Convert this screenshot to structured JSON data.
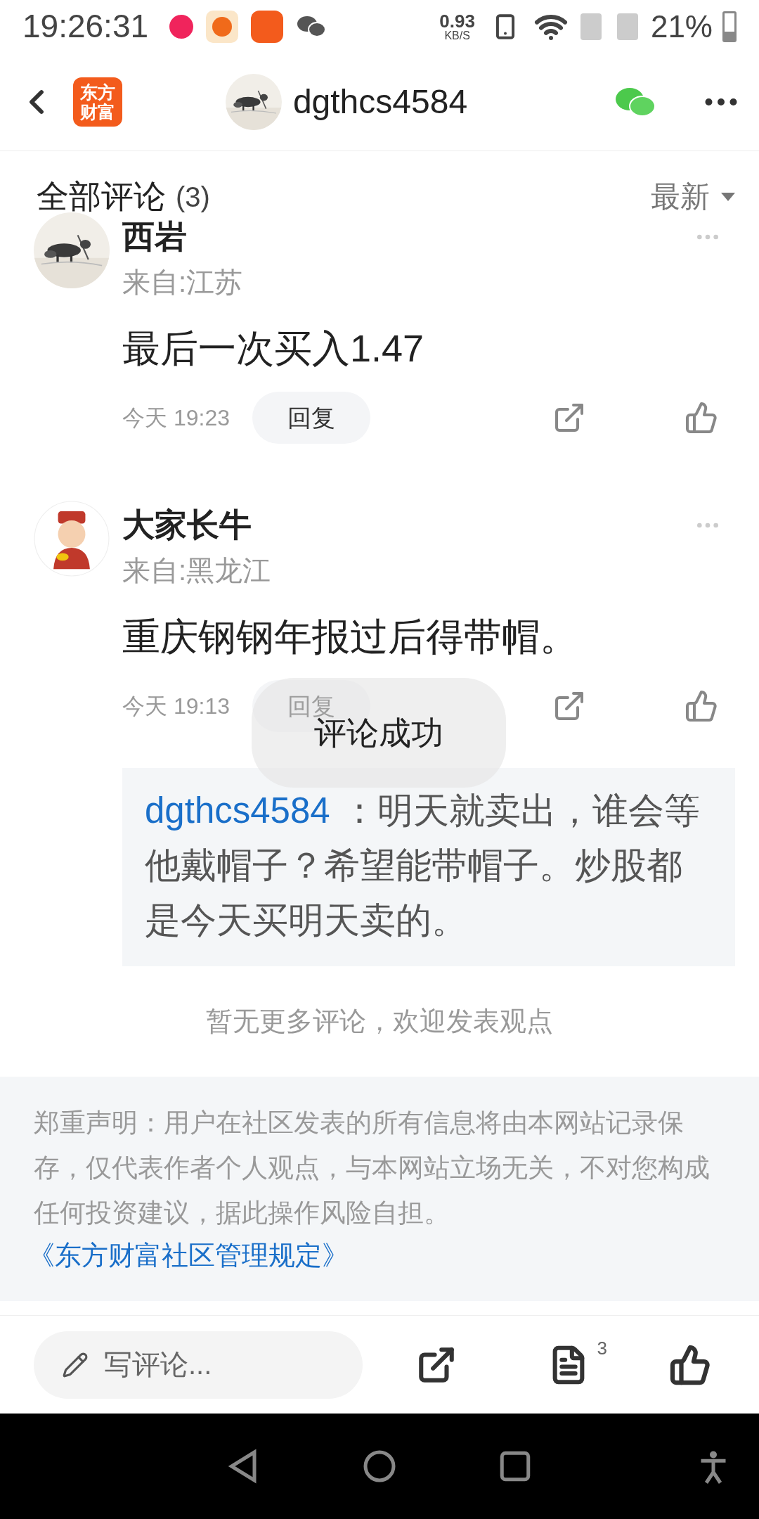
{
  "status_bar": {
    "time": "19:26:31",
    "net_speed": "0.93",
    "net_unit": "KB/S",
    "battery": "21%"
  },
  "header": {
    "logo_lines": [
      "东方",
      "财富"
    ],
    "title": "dgthcs4584"
  },
  "comments_header": {
    "title": "全部评论",
    "count": "(3)",
    "sort": "最新"
  },
  "comments": [
    {
      "name": "西岩",
      "location": "来自:江苏",
      "text": "最后一次买入1.47",
      "time": "今天 19:23",
      "reply_label": "回复"
    },
    {
      "avatar": {
        "kind": "icon"
      },
      "name": "大家长牛",
      "location": "来自:黑龙江",
      "text": "重庆钢钢年报过后得带帽。",
      "time": "今天 19:13",
      "reply_label": "回复",
      "replies": [
        {
          "author": "dgthcs4584",
          "text": "：明天就卖出，谁会等他戴帽子？希望能带帽子。炒股都是今天买明天卖的。"
        }
      ]
    }
  ],
  "end_note": "暂无更多评论，欢迎发表观点",
  "disclaimer": {
    "text": "郑重声明：用户在社区发表的所有信息将由本网站记录保存，仅代表作者个人观点，与本网站立场无关，不对您构成任何投资建议，据此操作风险自担。",
    "link": "《东方财富社区管理规定》"
  },
  "bottom_bar": {
    "placeholder": "写评论...",
    "comment_count": "3"
  },
  "toast": "评论成功"
}
